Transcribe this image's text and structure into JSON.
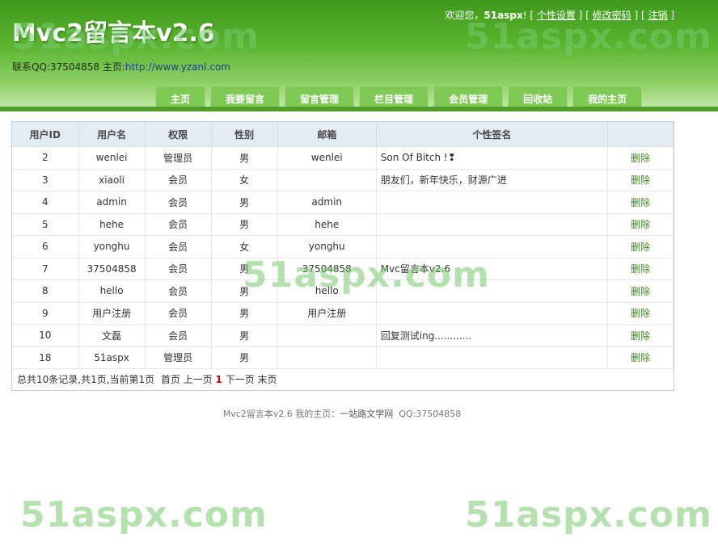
{
  "header": {
    "title": "Mvc2留言本v2.6",
    "contact_prefix": "联系QQ:37504858 主页:",
    "contact_link": "http://www.yzanl.com"
  },
  "userbar": {
    "welcome": "欢迎您，",
    "username": "51aspx",
    "exclaim": "!",
    "profile": "个性设置",
    "change_password": "修改密码",
    "logout": "注销"
  },
  "nav": [
    "主页",
    "我要留言",
    "留言管理",
    "栏目管理",
    "会员管理",
    "回收站",
    "我的主页"
  ],
  "watermark": "51aspx.com",
  "table": {
    "headers": [
      "用户ID",
      "用户名",
      "权限",
      "性别",
      "邮箱",
      "个性签名",
      ""
    ],
    "delete_label": "删除",
    "rows": [
      {
        "id": "2",
        "name": "wenlei",
        "role": "管理员",
        "sex": "男",
        "email": "wenlei",
        "sig": "Son Of Bitch !❢"
      },
      {
        "id": "3",
        "name": "xiaoli",
        "role": "会员",
        "sex": "女",
        "email": "",
        "sig": "朋友们，新年快乐，财源广进"
      },
      {
        "id": "4",
        "name": "admin",
        "role": "会员",
        "sex": "男",
        "email": "admin",
        "sig": ""
      },
      {
        "id": "5",
        "name": "hehe",
        "role": "会员",
        "sex": "男",
        "email": "hehe",
        "sig": ""
      },
      {
        "id": "6",
        "name": "yonghu",
        "role": "会员",
        "sex": "女",
        "email": "yonghu",
        "sig": ""
      },
      {
        "id": "7",
        "name": "37504858",
        "role": "会员",
        "sex": "男",
        "email": "37504858",
        "sig": "Mvc留言本v2.6"
      },
      {
        "id": "8",
        "name": "hello",
        "role": "会员",
        "sex": "男",
        "email": "hello",
        "sig": ""
      },
      {
        "id": "9",
        "name": "用户注册",
        "role": "会员",
        "sex": "男",
        "email": "用户注册",
        "sig": ""
      },
      {
        "id": "10",
        "name": "文磊",
        "role": "会员",
        "sex": "男",
        "email": "",
        "sig": "回复测试ing............"
      },
      {
        "id": "18",
        "name": "51aspx",
        "role": "管理员",
        "sex": "男",
        "email": "",
        "sig": ""
      }
    ]
  },
  "pager": {
    "summary": "总共10条记录,共1页,当前第1页",
    "first": "首页",
    "prev": "上一页",
    "current": "1",
    "next": "下一页",
    "last": "末页"
  },
  "footer": {
    "text": "Mvc2留言本v2.6 我的主页：",
    "link": "一站路文学网",
    "qq": "QQ:37504858"
  }
}
